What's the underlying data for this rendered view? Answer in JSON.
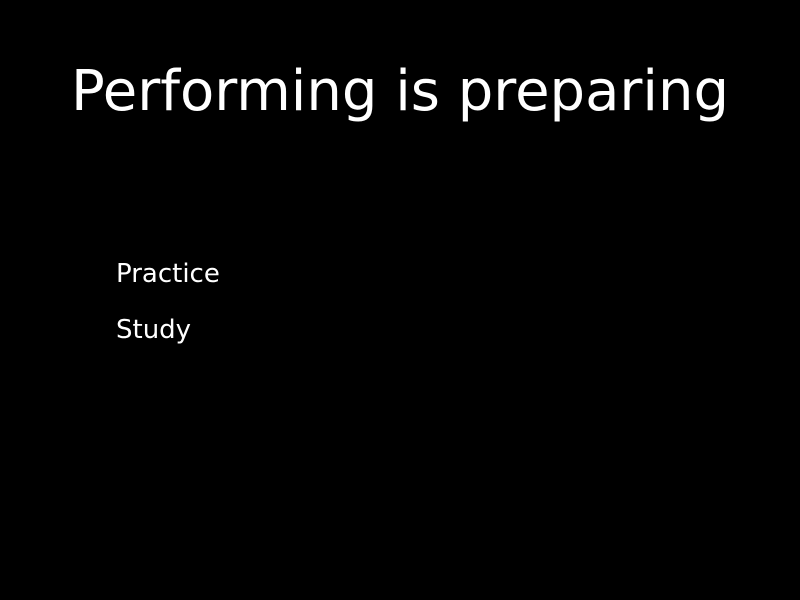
{
  "slide": {
    "title": "Performing is preparing",
    "bullets": [
      "Practice",
      "Study"
    ],
    "colors": {
      "background": "#000000",
      "text": "#ffffff"
    }
  }
}
